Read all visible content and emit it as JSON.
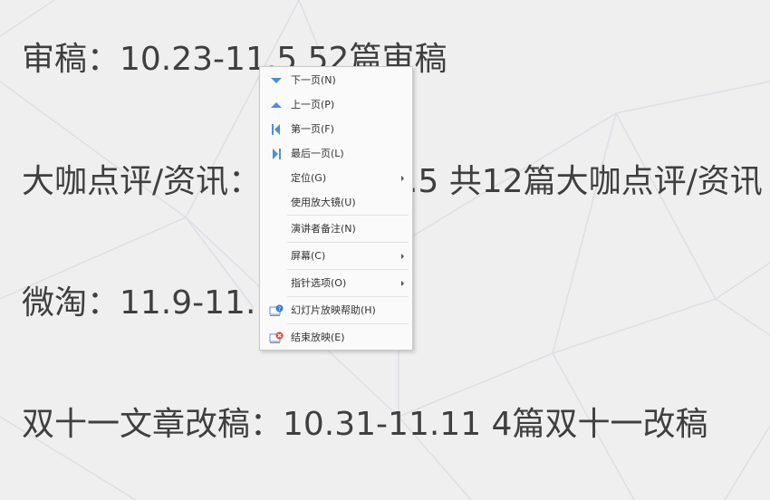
{
  "slide": {
    "lines": [
      "审稿：10.23-11.5 52篇审稿",
      "大咖点评/资讯：10.26-11.5 共12篇大咖点评/资讯",
      "微淘：11.9-11.10 微淘",
      "双十一文章改稿：10.31-11.11 4篇双十一改稿"
    ]
  },
  "context_menu": {
    "items": [
      {
        "label": "下一页(N)",
        "icon": "triangle-down-icon"
      },
      {
        "label": "上一页(P)",
        "icon": "triangle-up-icon"
      },
      {
        "label": "第一页(F)",
        "icon": "first-page-icon"
      },
      {
        "label": "最后一页(L)",
        "icon": "last-page-icon"
      },
      {
        "label": "定位(G)",
        "submenu": true
      },
      {
        "label": "使用放大镜(U)"
      },
      {
        "label": "演讲者备注(N)"
      },
      {
        "label": "屏幕(C)",
        "submenu": true
      },
      {
        "label": "指针选项(O)",
        "submenu": true
      },
      {
        "label": "幻灯片放映帮助(H)",
        "icon": "help-icon"
      },
      {
        "label": "结束放映(E)",
        "icon": "end-show-icon"
      }
    ]
  },
  "colors": {
    "icon_blue": "#4a90d9",
    "icon_red": "#e04040",
    "slide_text": "#3f3f3f"
  }
}
